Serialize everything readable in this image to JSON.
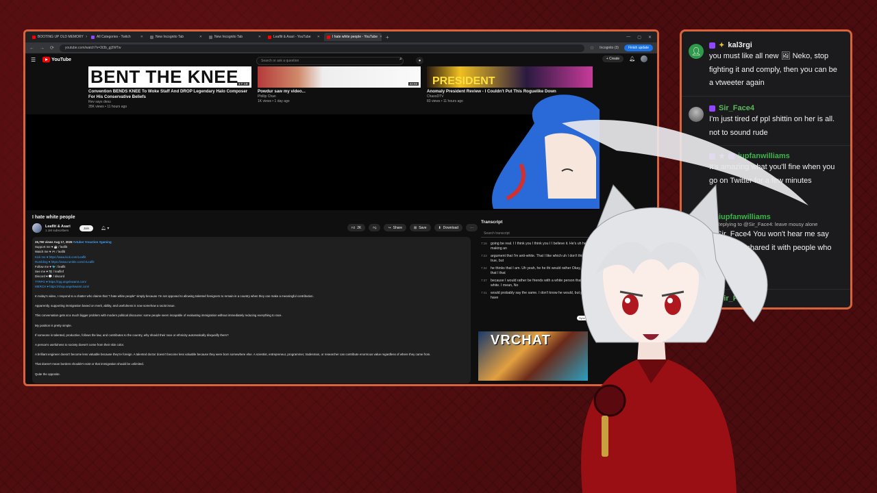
{
  "browser": {
    "tabs": [
      {
        "label": "BOOTING UP OLD MEMORY",
        "color": "#ff0000"
      },
      {
        "label": "All Categories - Twitch",
        "color": "#9147ff"
      },
      {
        "label": "New Incognito Tab",
        "color": "#666666"
      },
      {
        "label": "New Incognito Tab",
        "color": "#666666"
      },
      {
        "label": "Leaflit & Asari - YouTube",
        "color": "#ff0000"
      },
      {
        "label": "I hate white people - YouTube",
        "color": "#ff0000"
      }
    ],
    "url": "youtube.com/watch?v=3t3b_gj3WTw",
    "incognito_label": "Incognito (3)",
    "finish_update_label": "Finish update"
  },
  "youtube": {
    "logo_text": "YouTube",
    "search_placeholder": "Search or ask a question",
    "create_label": "+ Create",
    "recommendations": [
      {
        "thumb_text": "BENT THE KNEE",
        "badge": "17:18",
        "title": "Convention BENDS KNEE To Woke Staff And DROP Legendary Halo Composer For His Conservative Beliefs",
        "channel": "Rev says desu",
        "meta": "35K views • 11 hours ago"
      },
      {
        "thumb_text": "",
        "badge": "22:03",
        "title": "Powdur saw my video...",
        "channel": "Phillip Chan",
        "meta": "1K views • 1 day ago"
      },
      {
        "thumb_text": "PRESIDENT",
        "badge": "",
        "title": "Anomaly President Review - I Couldn't Put This Roguelike Down",
        "channel": "ChaosDTV",
        "meta": "83 views • 11 hours ago"
      }
    ],
    "video": {
      "title": "I hate white people",
      "channel": "Leaflit & Asari",
      "subscribers": "1.1M subscribers",
      "join_label": "Join",
      "likes": "2K",
      "share_label": "Share",
      "save_label": "Save",
      "download_label": "Download"
    },
    "description": {
      "stats": "26,790 views  Aug 17, 2026",
      "tags": "#vtuber #reaction #gaming",
      "links": [
        "Support me ♥ ☕ / leaflit",
        "Watch me ♥ 🎮 / leaflit",
        "Kick me ♥ https://www.kick.com/Leaflit",
        "Rumbling ♥ https://www.rumble.com/c/Leaflit",
        "Follow me ♥ 🐦 / leaflit",
        "See me ♥ 📷 / leaflinf",
        "Discord ♥ 💬 / discord",
        "TTRPG ♥ https://rpg.angelswamt.com/",
        "MERCH ♥ https://shop.angelswamt.com/"
      ],
      "paragraphs": [
        "In today's video, I respond to a chatter who claims that \"I hate white people\" simply because I'm not opposed to allowing talented foreigners to remain in a country when they can make a meaningful contribution.",
        "Apparently, supporting immigration based on merit, ability, and usefulness is now somehow a racist issue.",
        "This conversation gets at a much bigger problem with modern political discourse: some people seem incapable of evaluating immigration without immediately reducing everything to race.",
        "My position is pretty simple.",
        "If someone is talented, productive, follows the law, and contributes to the country, why should their race or ethnicity automatically disqualify them?",
        "A person's usefulness to society doesn't come from their skin color.",
        "A brilliant engineer doesn't become less valuable because they're foreign. A talented doctor doesn't become less valuable because they were born somewhere else. A scientist, entrepreneur, programmer, tradesman, or researcher can contribute enormous value regardless of where they came from.",
        "That doesn't mean borders shouldn't exist or that immigration should be unlimited.",
        "Quite the opposite."
      ]
    },
    "transcript": {
      "title": "Transcript",
      "search_placeholder": "Search transcript",
      "sync_label": "Sync to video",
      "thumb_text": "VRCHAT",
      "rows": [
        {
          "time": "7:16",
          "text": "going be real. I I think you I think you I I believe it. He's uh he's making an"
        },
        {
          "time": "7:23",
          "text": "argument that I'm anti-white. That I like which uh I don't think that's true, but"
        },
        {
          "time": "7:32",
          "text": "he thinks that I am. Uh yeah, he he thi would rather Okay, he said that I that"
        },
        {
          "time": "7:37",
          "text": "because I would rather be friends with a white person that I'm anti-white. I mean, No"
        },
        {
          "time": "7:41",
          "text": "would probably say the same. I don't know he would, but people have"
        }
      ]
    }
  },
  "chat": {
    "messages": [
      {
        "user": "kal3rgi",
        "color": "#f0f0f0",
        "reply": "",
        "text": "you must like all new 🖼 Neko, stop fighting it and comply, then you can be a vtweeter again"
      },
      {
        "user": "Sir_Face4",
        "color": "#5cb85c",
        "reply": "",
        "text": "I'm just tired of ppl shittin on her is all. not to sound rude"
      },
      {
        "user": "iupfanwilliams",
        "color": "#39b54a",
        "reply": "",
        "text": "It's amazing what you'll fine when you go on Twitter for a few minutes"
      },
      {
        "user": "iupfanwilliams",
        "color": "#39b54a",
        "reply": "↩ Replying to @Sir_Face4: leave mousy alone",
        "text": "@Sir_Face4 You won't hear me say more I just shared it with people who didn't believe"
      },
      {
        "user": "Sir_Face4",
        "color": "#5cb85c",
        "reply": "",
        "text": ""
      }
    ]
  }
}
